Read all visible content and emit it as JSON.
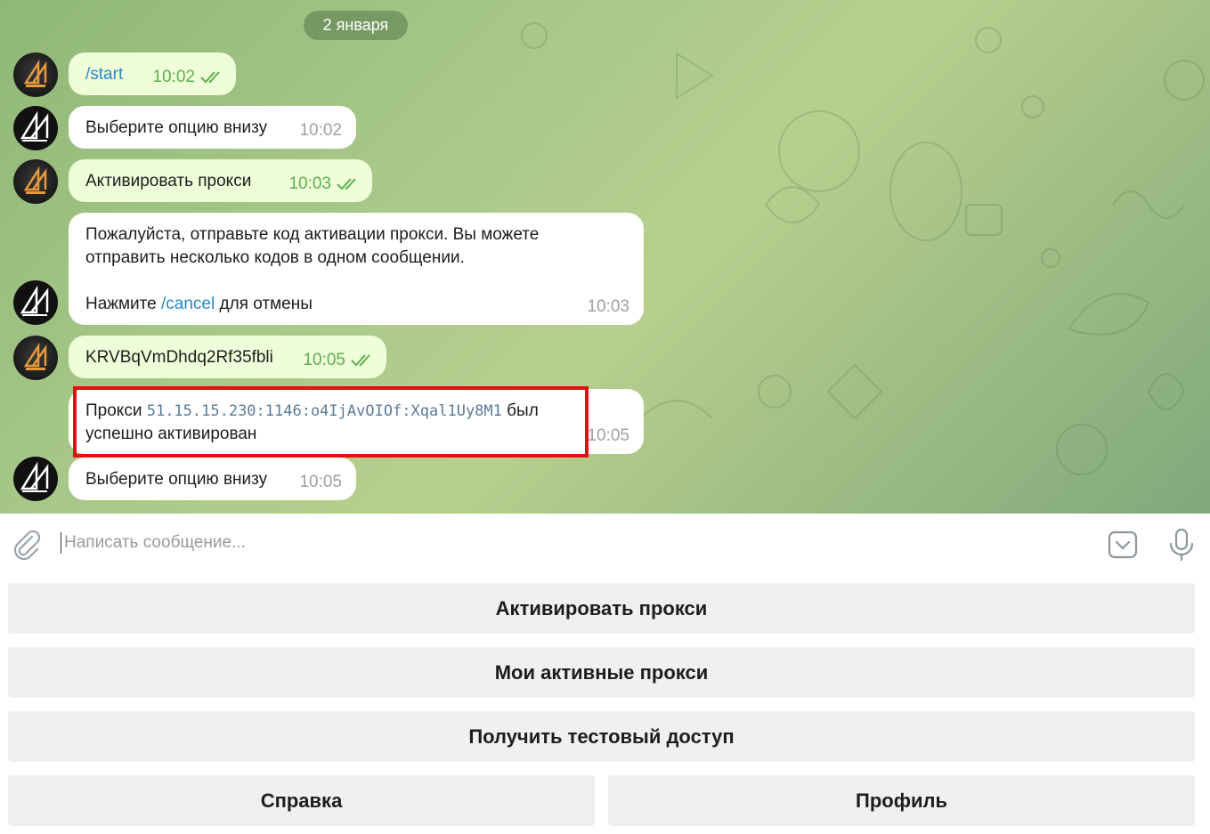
{
  "chat": {
    "date_separator": "2 января",
    "messages": [
      {
        "direction": "out",
        "text": "/start",
        "time": "10:02",
        "is_command": true
      },
      {
        "direction": "in",
        "text": "Выберите опцию внизу",
        "time": "10:02"
      },
      {
        "direction": "out",
        "text": "Активировать прокси",
        "time": "10:03"
      },
      {
        "direction": "in",
        "line1": "Пожалуйста, отправьте код активации прокси. Вы можете",
        "line2": "отправить несколько кодов в одном сообщении.",
        "line3_prefix": "Нажмите ",
        "line3_cmd": "/cancel",
        "line3_suffix": " для отмены",
        "time": "10:03"
      },
      {
        "direction": "out",
        "text": "KRVBqVmDhdq2Rf35fbli",
        "time": "10:05"
      },
      {
        "direction": "in",
        "prefix": "Прокси ",
        "proxy": "51.15.15.230:1146:o4IjAvOIOf:Xqal1Uy8M1",
        "suffix": " был",
        "line2": "успешно активирован",
        "time": "10:05"
      },
      {
        "direction": "in",
        "text": "Выберите опцию внизу",
        "time": "10:05"
      }
    ]
  },
  "composer": {
    "placeholder": "Написать сообщение..."
  },
  "keyboard": {
    "activate": "Активировать прокси",
    "my_proxies": "Мои активные прокси",
    "test_access": "Получить тестовый доступ",
    "help": "Справка",
    "profile": "Профиль"
  },
  "colors": {
    "outgoing_bubble": "#eefed9",
    "incoming_bubble": "#ffffff",
    "link": "#2a8ac4",
    "read_ticks": "#5fae4e",
    "highlight": "#e01010"
  }
}
